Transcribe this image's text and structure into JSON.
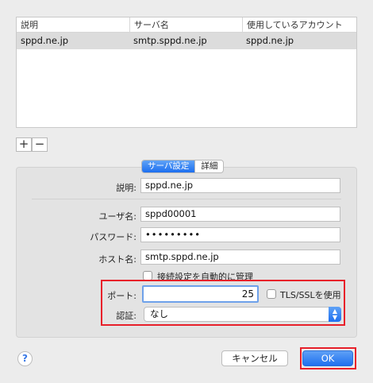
{
  "accounts_table": {
    "columns": [
      "説明",
      "サーバ名",
      "使用しているアカウント"
    ],
    "rows": [
      [
        "sppd.ne.jp",
        "smtp.sppd.ne.jp",
        "sppd.ne.jp"
      ]
    ]
  },
  "list_controls": {
    "add": "+",
    "remove": "−"
  },
  "tabs": {
    "server_settings": "サーバ設定",
    "advanced": "詳細"
  },
  "form": {
    "description_label": "説明:",
    "description_value": "sppd.ne.jp",
    "username_label": "ユーザ名:",
    "username_value": "sppd00001",
    "password_label": "パスワード:",
    "password_value": "•••••••••",
    "host_label": "ホスト名:",
    "host_value": "smtp.sppd.ne.jp",
    "auto_manage_label": "接続設定を自動的に管理",
    "auto_manage_checked": false,
    "port_label": "ポート:",
    "port_value": "25",
    "tls_label": "TLS/SSLを使用",
    "tls_checked": false,
    "auth_label": "認証:",
    "auth_value": "なし"
  },
  "footer": {
    "help": "?",
    "cancel": "キャンセル",
    "ok": "OK"
  },
  "colors": {
    "accent": "#1d6ff0",
    "highlight_box": "#e8202a"
  }
}
